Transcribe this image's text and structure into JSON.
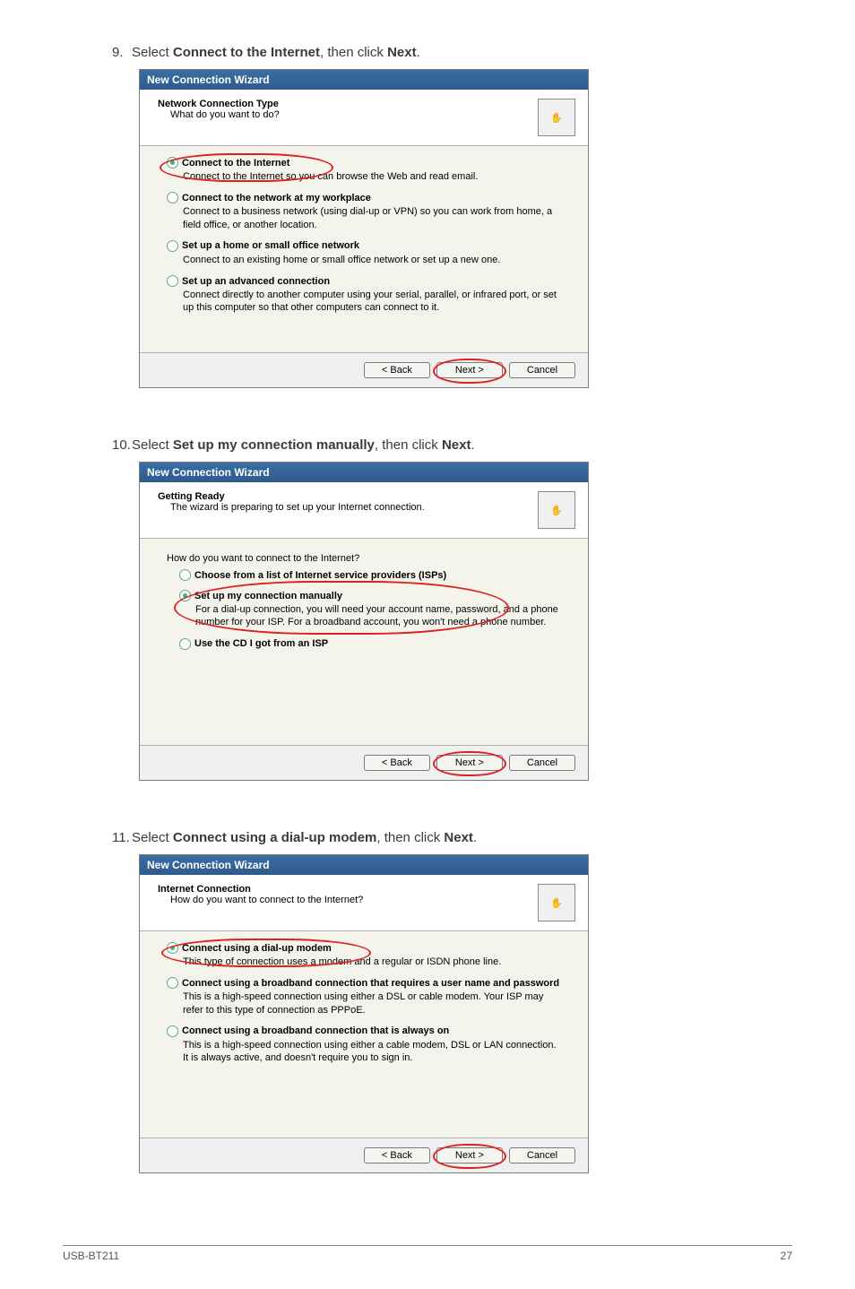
{
  "step9": {
    "num": "9.",
    "pre": "Select ",
    "bold1": "Connect to the Internet",
    "mid": ", then click ",
    "bold2": "Next",
    "end": "."
  },
  "step10": {
    "num": "10.",
    "pre": "Select ",
    "bold1": "Set up my connection manually",
    "mid": ", then click ",
    "bold2": "Next",
    "end": "."
  },
  "step11": {
    "num": "11.",
    "pre": "Select ",
    "bold1": "Connect using a dial-up modem",
    "mid": ", then click ",
    "bold2": "Next",
    "end": "."
  },
  "dlg1": {
    "title": "New Connection Wizard",
    "h_title": "Network Connection Type",
    "h_sub": "What do you want to do?",
    "opt1_t": "Connect to the Internet",
    "opt1_d": "Connect to the Internet so you can browse the Web and read email.",
    "opt2_t": "Connect to the network at my workplace",
    "opt2_d": "Connect to a business network (using dial-up or VPN) so you can work from home, a field office, or another location.",
    "opt3_t": "Set up a home or small office network",
    "opt3_d": "Connect to an existing home or small office network or set up a new one.",
    "opt4_t": "Set up an advanced connection",
    "opt4_d": "Connect directly to another computer using your serial, parallel, or infrared port, or set up this computer so that other computers can connect to it.",
    "back": "< Back",
    "next": "Next >",
    "cancel": "Cancel"
  },
  "dlg2": {
    "title": "New Connection Wizard",
    "h_title": "Getting Ready",
    "h_sub": "The wizard is preparing to set up your Internet connection.",
    "intro": "How do you want to connect to the Internet?",
    "opt1_t": "Choose from a list of Internet service providers (ISPs)",
    "opt2_t": "Set up my connection manually",
    "opt2_d": "For a dial-up connection, you will need your account name, password, and a phone number for your ISP. For a broadband account, you won't need a phone number.",
    "opt3_t": "Use the CD I got from an ISP",
    "back": "< Back",
    "next": "Next >",
    "cancel": "Cancel"
  },
  "dlg3": {
    "title": "New Connection Wizard",
    "h_title": "Internet Connection",
    "h_sub": "How do you want to connect to the Internet?",
    "opt1_t": "Connect using a dial-up modem",
    "opt1_d": "This type of connection uses a modem and a regular or ISDN phone line.",
    "opt2_t": "Connect using a broadband connection that requires a user name and password",
    "opt2_d": "This is a high-speed connection using either a DSL or cable modem. Your ISP may refer to this type of connection as PPPoE.",
    "opt3_t": "Connect using a broadband connection that is always on",
    "opt3_d": "This is a high-speed connection using either a cable modem, DSL or LAN connection. It is always active, and doesn't require you to sign in.",
    "back": "< Back",
    "next": "Next >",
    "cancel": "Cancel"
  },
  "footer": {
    "left": "USB-BT211",
    "right": "27"
  },
  "icon": "✋"
}
